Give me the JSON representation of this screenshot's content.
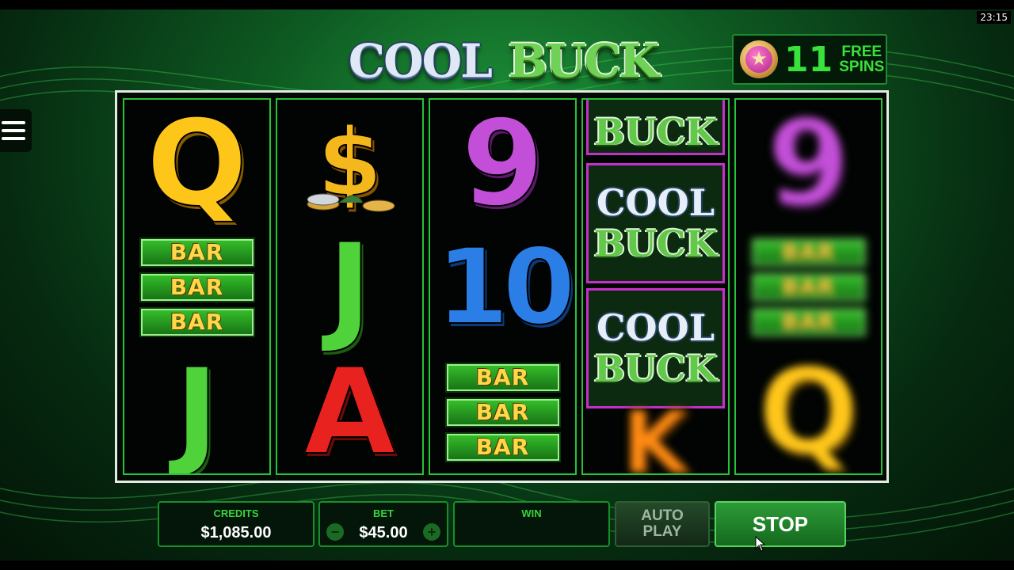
{
  "status_bar": {
    "time": "23:15"
  },
  "logo": {
    "word1": "COOL",
    "word2": "BUCK"
  },
  "free_spins": {
    "count": "11",
    "line1": "FREE",
    "line2": "SPINS",
    "icon": "star-icon"
  },
  "menu": {
    "icon": "menu-icon"
  },
  "reels": [
    {
      "symbols": [
        "Q",
        "BAR",
        "J"
      ]
    },
    {
      "symbols": [
        "$",
        "J",
        "A"
      ]
    },
    {
      "symbols": [
        "9",
        "10",
        "BAR"
      ]
    },
    {
      "symbols": [
        "COOL BUCK",
        "COOL BUCK",
        "COOL BUCK",
        "K"
      ]
    },
    {
      "symbols": [
        "9",
        "BAR",
        "Q"
      ],
      "spinning": true
    }
  ],
  "symbol_text": {
    "bar": "BAR",
    "q": "Q",
    "j": "J",
    "a": "A",
    "nine": "9",
    "ten": "10",
    "k": "K",
    "dollar": "$",
    "cool": "COOL",
    "buck": "BUCK"
  },
  "panel": {
    "credits_label": "CREDITS",
    "credits_value": "$1,085.00",
    "bet_label": "BET",
    "bet_value": "$45.00",
    "bet_minus": "−",
    "bet_plus": "+",
    "win_label": "WIN",
    "win_value": "",
    "autoplay_line1": "AUTO",
    "autoplay_line2": "PLAY",
    "stop_label": "STOP"
  },
  "colors": {
    "accent_green": "#38d53a",
    "frame_green": "#27c23a",
    "wild_border": "#c62fc9"
  }
}
